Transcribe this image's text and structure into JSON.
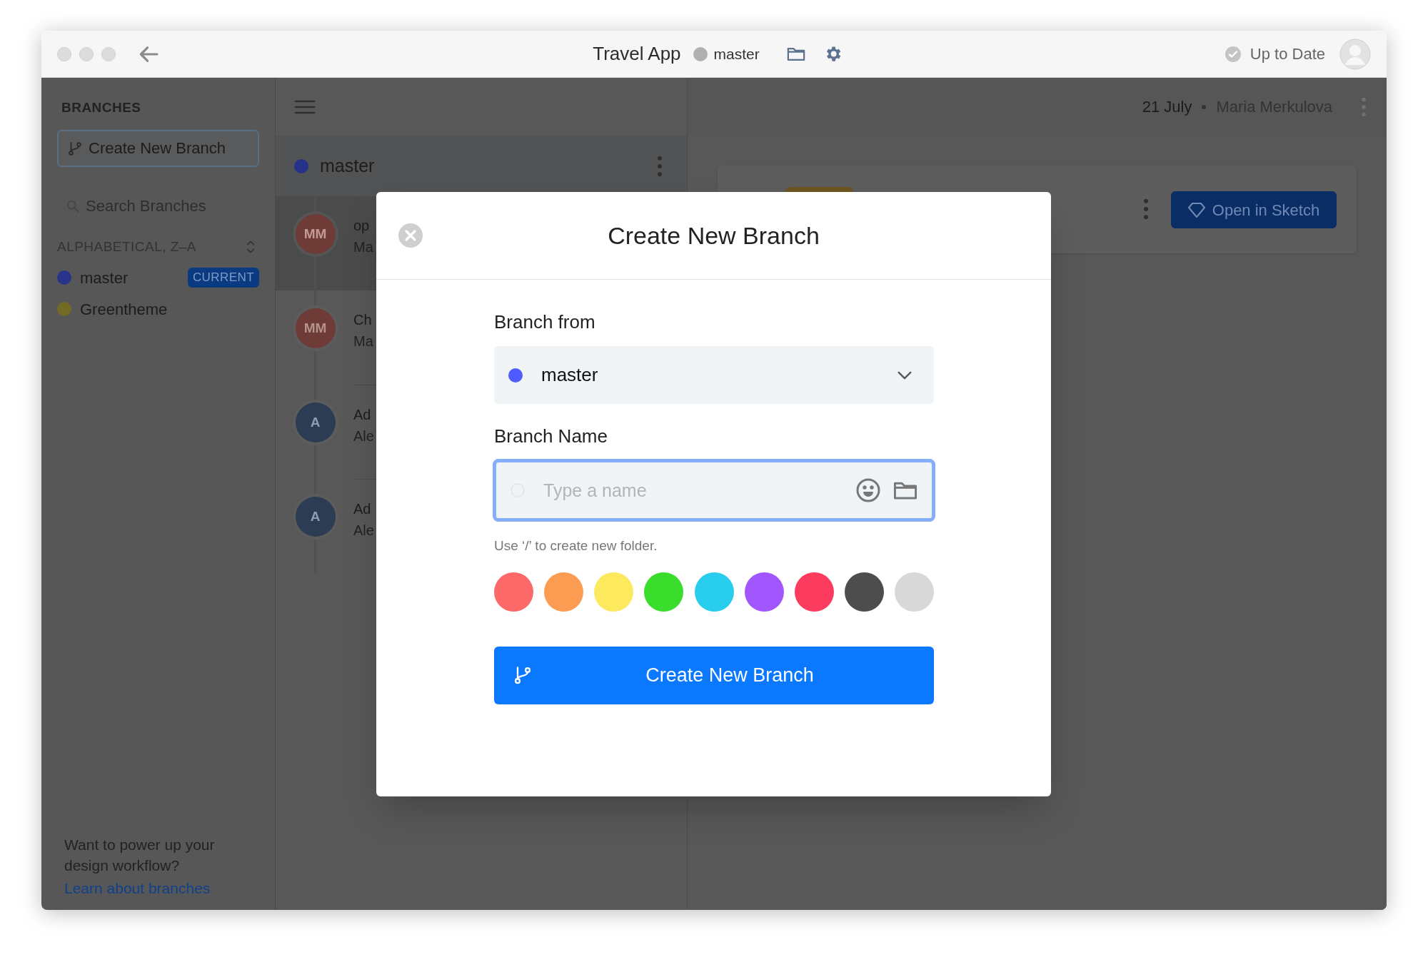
{
  "window": {
    "title": "Travel App",
    "branch": "master",
    "status": "Up to Date"
  },
  "sidebar": {
    "heading": "BRANCHES",
    "create_button": "Create New Branch",
    "search": {
      "placeholder": "Search Branches"
    },
    "sort": "ALPHABETICAL, Z–A",
    "branches": [
      {
        "name": "master",
        "color": "#28338a",
        "badge": "CURRENT"
      },
      {
        "name": "Greentheme",
        "color": "#736a24"
      }
    ],
    "promo": "Want to power up your design workflow?",
    "link": "Learn about branches"
  },
  "history": {
    "branch": {
      "name": "master",
      "color": "#25318a"
    },
    "items": [
      {
        "initials": "MM",
        "title": "op",
        "author": "Ma",
        "color": "#6e3b37",
        "selected": true
      },
      {
        "initials": "MM",
        "title": "Ch",
        "author": "Ma",
        "color": "#6e3b37",
        "selected": false
      },
      {
        "initials": "A",
        "title": "Ad",
        "author": "Ale",
        "color": "#2c3c52",
        "selected": false
      },
      {
        "initials": "A",
        "title": "Ad",
        "author": "Ale",
        "color": "#2c3c52",
        "selected": false
      }
    ]
  },
  "detail": {
    "date": "21 July",
    "author": "Maria Merkulova",
    "button": "Open in Sketch"
  },
  "modal": {
    "title": "Create New Branch",
    "from_label": "Branch from",
    "from": {
      "name": "master",
      "color": "#4f5bff"
    },
    "name_label": "Branch Name",
    "name_field": {
      "placeholder": "Type a name"
    },
    "hint": "Use ‘/’ to create new folder.",
    "swatches": [
      {
        "color": "#fd6868"
      },
      {
        "color": "#fc9b52"
      },
      {
        "color": "#fde95d"
      },
      {
        "color": "#3add2c"
      },
      {
        "color": "#28cdee"
      },
      {
        "color": "#a257fe"
      },
      {
        "color": "#fc3c5f"
      },
      {
        "color": "#4d4d4d"
      },
      {
        "color": "#d8d8d8"
      }
    ],
    "submit": "Create New Branch"
  }
}
